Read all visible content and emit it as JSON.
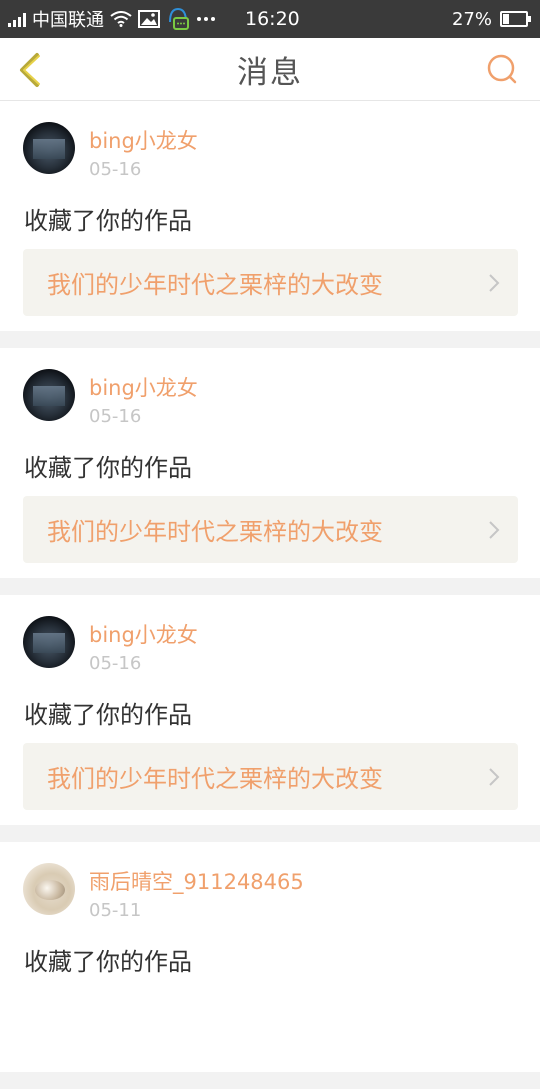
{
  "status_bar": {
    "carrier": "中国联通",
    "time": "16:20",
    "battery": "27%",
    "battery_level": 0.27
  },
  "nav": {
    "title": "消息",
    "back_icon": "chevron-left-icon",
    "search_icon": "search-icon",
    "accent_color": "#f0a06c"
  },
  "messages": [
    {
      "username": "bing小龙女",
      "date": "05-16",
      "action": "收藏了你的作品",
      "work_title": "我们的少年时代之栗梓的大改变",
      "avatar": "dark"
    },
    {
      "username": "bing小龙女",
      "date": "05-16",
      "action": "收藏了你的作品",
      "work_title": "我们的少年时代之栗梓的大改变",
      "avatar": "dark"
    },
    {
      "username": "bing小龙女",
      "date": "05-16",
      "action": "收藏了你的作品",
      "work_title": "我们的少年时代之栗梓的大改变",
      "avatar": "dark"
    },
    {
      "username": "雨后晴空_911248465",
      "date": "05-11",
      "action": "收藏了你的作品",
      "work_title": "",
      "avatar": "light"
    }
  ]
}
